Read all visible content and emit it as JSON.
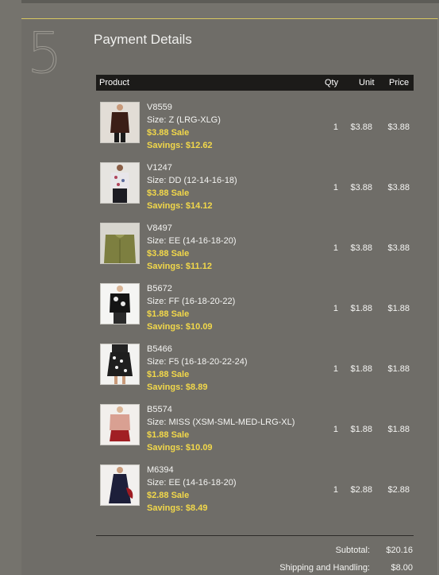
{
  "step": {
    "number": "5",
    "title": "Payment Details"
  },
  "table": {
    "headers": {
      "product": "Product",
      "qty": "Qty",
      "unit": "Unit",
      "price": "Price"
    },
    "rows": [
      {
        "sku": "V8559",
        "size": "Size: Z (LRG-XLG)",
        "sale": "$3.88 Sale",
        "savings": "Savings: $12.62",
        "qty": "1",
        "unit": "$3.88",
        "price": "$3.88",
        "icon": "jacket-product-thumbnail"
      },
      {
        "sku": "V1247",
        "size": "Size: DD (12-14-16-18)",
        "sale": "$3.88 Sale",
        "savings": "Savings: $14.12",
        "qty": "1",
        "unit": "$3.88",
        "price": "$3.88",
        "icon": "printed-top-product-thumbnail"
      },
      {
        "sku": "V8497",
        "size": "Size: EE (14-16-18-20)",
        "sale": "$3.88 Sale",
        "savings": "Savings: $11.12",
        "qty": "1",
        "unit": "$3.88",
        "price": "$3.88",
        "icon": "cardigan-product-thumbnail"
      },
      {
        "sku": "B5672",
        "size": "Size: FF (16-18-20-22)",
        "sale": "$1.88 Sale",
        "savings": "Savings: $10.09",
        "qty": "1",
        "unit": "$1.88",
        "price": "$1.88",
        "icon": "floral-blouse-product-thumbnail"
      },
      {
        "sku": "B5466",
        "size": "Size: F5 (16-18-20-22-24)",
        "sale": "$1.88 Sale",
        "savings": "Savings: $8.89",
        "qty": "1",
        "unit": "$1.88",
        "price": "$1.88",
        "icon": "printed-skirt-product-thumbnail"
      },
      {
        "sku": "B5574",
        "size": "Size: MISS (XSM-SML-MED-LRG-XL)",
        "sale": "$1.88 Sale",
        "savings": "Savings: $10.09",
        "qty": "1",
        "unit": "$1.88",
        "price": "$1.88",
        "icon": "pink-jacket-product-thumbnail"
      },
      {
        "sku": "M6394",
        "size": "Size: EE (14-16-18-20)",
        "sale": "$2.88 Sale",
        "savings": "Savings: $8.49",
        "qty": "1",
        "unit": "$2.88",
        "price": "$2.88",
        "icon": "dress-product-thumbnail"
      }
    ]
  },
  "summary": {
    "subtotal_label": "Subtotal:",
    "subtotal_value": "$20.16",
    "shipping_label": "Shipping and Handling:",
    "shipping_value": "$8.00"
  },
  "colors": {
    "sale": "#f2d84a",
    "panel": "#6f6d68",
    "header": "#1c1b19",
    "accent_line": "#d8c860"
  }
}
